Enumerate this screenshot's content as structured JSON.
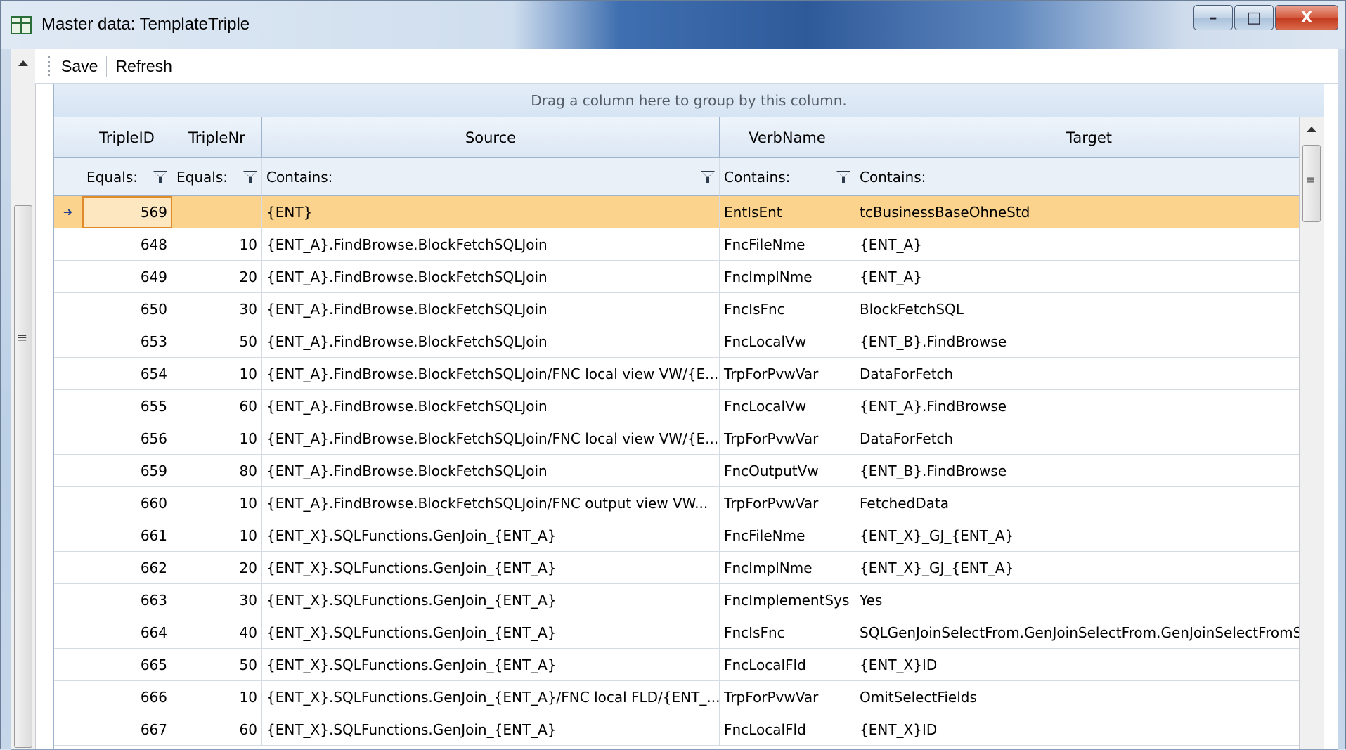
{
  "window": {
    "title": "Master data: TemplateTriple",
    "minimize": "–",
    "maximize": "□",
    "close": "X"
  },
  "toolbar": {
    "save_label": "Save",
    "refresh_label": "Refresh"
  },
  "grid": {
    "group_hint": "Drag a column here to group by this column.",
    "columns": [
      "TripleID",
      "TripleNr",
      "Source",
      "VerbName",
      "Target"
    ],
    "filters": [
      "Equals:",
      "Equals:",
      "Contains:",
      "Contains:",
      "Contains:"
    ],
    "current_row_marker": "➜",
    "rows": [
      {
        "id": "569",
        "nr": "",
        "source": "{ENT}",
        "verb": "EntIsEnt",
        "target": "tcBusinessBaseOhneStd"
      },
      {
        "id": "648",
        "nr": "10",
        "source": "{ENT_A}.FindBrowse.BlockFetchSQLJoin",
        "verb": "FncFileNme",
        "target": "{ENT_A}"
      },
      {
        "id": "649",
        "nr": "20",
        "source": "{ENT_A}.FindBrowse.BlockFetchSQLJoin",
        "verb": "FncImplNme",
        "target": "{ENT_A}"
      },
      {
        "id": "650",
        "nr": "30",
        "source": "{ENT_A}.FindBrowse.BlockFetchSQLJoin",
        "verb": "FncIsFnc",
        "target": "BlockFetchSQL"
      },
      {
        "id": "653",
        "nr": "50",
        "source": "{ENT_A}.FindBrowse.BlockFetchSQLJoin",
        "verb": "FncLocalVw",
        "target": "{ENT_B}.FindBrowse"
      },
      {
        "id": "654",
        "nr": "10",
        "source": "{ENT_A}.FindBrowse.BlockFetchSQLJoin/FNC local view VW/{E...",
        "verb": "TrpForPvwVar",
        "target": "DataForFetch"
      },
      {
        "id": "655",
        "nr": "60",
        "source": "{ENT_A}.FindBrowse.BlockFetchSQLJoin",
        "verb": "FncLocalVw",
        "target": "{ENT_A}.FindBrowse"
      },
      {
        "id": "656",
        "nr": "10",
        "source": "{ENT_A}.FindBrowse.BlockFetchSQLJoin/FNC local view VW/{E...",
        "verb": "TrpForPvwVar",
        "target": "DataForFetch"
      },
      {
        "id": "659",
        "nr": "80",
        "source": "{ENT_A}.FindBrowse.BlockFetchSQLJoin",
        "verb": "FncOutputVw",
        "target": "{ENT_B}.FindBrowse"
      },
      {
        "id": "660",
        "nr": "10",
        "source": "{ENT_A}.FindBrowse.BlockFetchSQLJoin/FNC output view VW...",
        "verb": "TrpForPvwVar",
        "target": "FetchedData"
      },
      {
        "id": "661",
        "nr": "10",
        "source": "{ENT_X}.SQLFunctions.GenJoin_{ENT_A}",
        "verb": "FncFileNme",
        "target": "{ENT_X}_GJ_{ENT_A}"
      },
      {
        "id": "662",
        "nr": "20",
        "source": "{ENT_X}.SQLFunctions.GenJoin_{ENT_A}",
        "verb": "FncImplNme",
        "target": "{ENT_X}_GJ_{ENT_A}"
      },
      {
        "id": "663",
        "nr": "30",
        "source": "{ENT_X}.SQLFunctions.GenJoin_{ENT_A}",
        "verb": "FncImplementSys",
        "target": "Yes"
      },
      {
        "id": "664",
        "nr": "40",
        "source": "{ENT_X}.SQLFunctions.GenJoin_{ENT_A}",
        "verb": "FncIsFnc",
        "target": "SQLGenJoinSelectFrom.GenJoinSelectFrom.GenJoinSelectFromSt"
      },
      {
        "id": "665",
        "nr": "50",
        "source": "{ENT_X}.SQLFunctions.GenJoin_{ENT_A}",
        "verb": "FncLocalFld",
        "target": "{ENT_X}ID"
      },
      {
        "id": "666",
        "nr": "10",
        "source": "{ENT_X}.SQLFunctions.GenJoin_{ENT_A}/FNC local FLD/{ENT_...",
        "verb": "TrpForPvwVar",
        "target": "OmitSelectFields"
      },
      {
        "id": "667",
        "nr": "60",
        "source": "{ENT_X}.SQLFunctions.GenJoin_{ENT_A}",
        "verb": "FncLocalFld",
        "target": "{ENT_X}ID"
      }
    ]
  }
}
